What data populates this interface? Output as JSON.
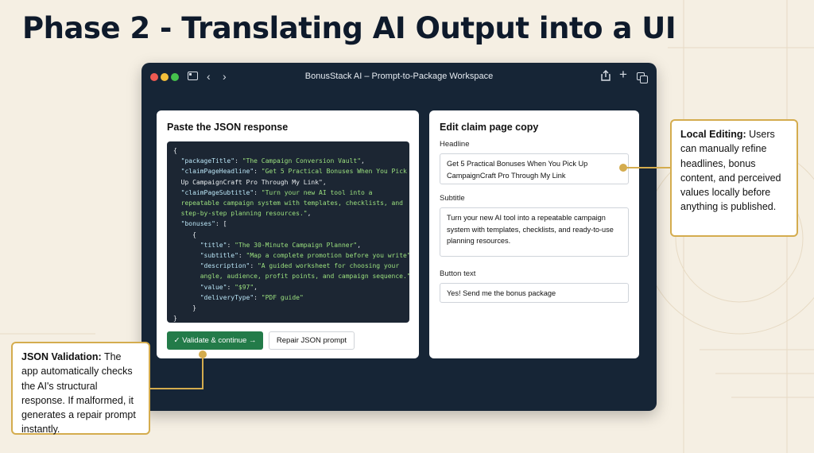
{
  "slide": {
    "title": "Phase 2 - Translating AI Output into a UI"
  },
  "window": {
    "title": "BonusStack AI – Prompt-to-Package Workspace"
  },
  "left_panel": {
    "title": "Paste the JSON response",
    "code_lines": [
      [
        {
          "t": "{",
          "c": ""
        }
      ],
      [
        {
          "t": "  \"packageTitle\"",
          "c": "k"
        },
        {
          "t": ": ",
          "c": ""
        },
        {
          "t": "\"The Campaign Conversion Vault\"",
          "c": "s"
        },
        {
          "t": ",",
          "c": ""
        }
      ],
      [
        {
          "t": "  \"claimPageHeadline\"",
          "c": "k"
        },
        {
          "t": ": ",
          "c": ""
        },
        {
          "t": "\"Get 5 Practical Bonuses When You Pick",
          "c": "s"
        }
      ],
      [
        {
          "t": "  Up CampaignCraft Pro Through My Link\"",
          "c": ""
        },
        {
          "t": ",",
          "c": ""
        }
      ],
      [
        {
          "t": "  \"claimPageSubtitle\"",
          "c": "k"
        },
        {
          "t": ": ",
          "c": ""
        },
        {
          "t": "\"Turn your new AI tool into a",
          "c": "s"
        }
      ],
      [
        {
          "t": "  repeatable campaign system with templates, checklists, and",
          "c": "s"
        }
      ],
      [
        {
          "t": "  step-by-step planning resources.\"",
          "c": "s"
        },
        {
          "t": ",",
          "c": ""
        }
      ],
      [
        {
          "t": "  \"bonuses\"",
          "c": "k"
        },
        {
          "t": ": [",
          "c": ""
        }
      ],
      [
        {
          "t": "     {",
          "c": ""
        }
      ],
      [
        {
          "t": "       \"title\"",
          "c": "k"
        },
        {
          "t": ": ",
          "c": ""
        },
        {
          "t": "\"The 30-Minute Campaign Planner\"",
          "c": "s"
        },
        {
          "t": ",",
          "c": ""
        }
      ],
      [
        {
          "t": "       \"subtitle\"",
          "c": "k"
        },
        {
          "t": ": ",
          "c": ""
        },
        {
          "t": "\"Map a complete promotion before you write\"",
          "c": "s"
        },
        {
          "t": ",",
          "c": ""
        }
      ],
      [
        {
          "t": "       \"description\"",
          "c": "k"
        },
        {
          "t": ": ",
          "c": ""
        },
        {
          "t": "\"A guided worksheet for choosing your",
          "c": "s"
        }
      ],
      [
        {
          "t": "       angle, audience, profit points, and campaign sequence.\"",
          "c": "s"
        },
        {
          "t": ",",
          "c": ""
        }
      ],
      [
        {
          "t": "       \"value\"",
          "c": "k"
        },
        {
          "t": ": ",
          "c": ""
        },
        {
          "t": "\"$97\"",
          "c": "s"
        },
        {
          "t": ",",
          "c": ""
        }
      ],
      [
        {
          "t": "       \"deliveryType\"",
          "c": "k"
        },
        {
          "t": ": ",
          "c": ""
        },
        {
          "t": "\"PDF guide\"",
          "c": "s"
        }
      ],
      [
        {
          "t": "     }",
          "c": ""
        }
      ],
      [
        {
          "t": "}",
          "c": ""
        }
      ]
    ],
    "validate_label": "✓ Validate & continue →",
    "repair_label": "Repair JSON prompt"
  },
  "right_panel": {
    "title": "Edit claim page copy",
    "headline_label": "Headline",
    "headline_value": "Get 5 Practical Bonuses When You Pick Up CampaignCraft Pro Through My Link",
    "subtitle_label": "Subtitle",
    "subtitle_value": "Turn your new AI tool into a repeatable campaign system with templates, checklists, and ready-to-use planning resources.",
    "button_label": "Button text",
    "button_value": "Yes! Send me the bonus package"
  },
  "callouts": {
    "local_editing_heading": "Local Editing:",
    "local_editing_body": " Users can manually refine headlines, bonus content, and perceived values locally before anything is published.",
    "json_validation_heading": "JSON Validation:",
    "json_validation_body": " The app automatically checks the AI's structural response. If malformed, it generates a repair prompt instantly."
  },
  "colors": {
    "accent_gold": "#d4ac4e",
    "window_bg": "#162536",
    "validate_green": "#237b49"
  }
}
